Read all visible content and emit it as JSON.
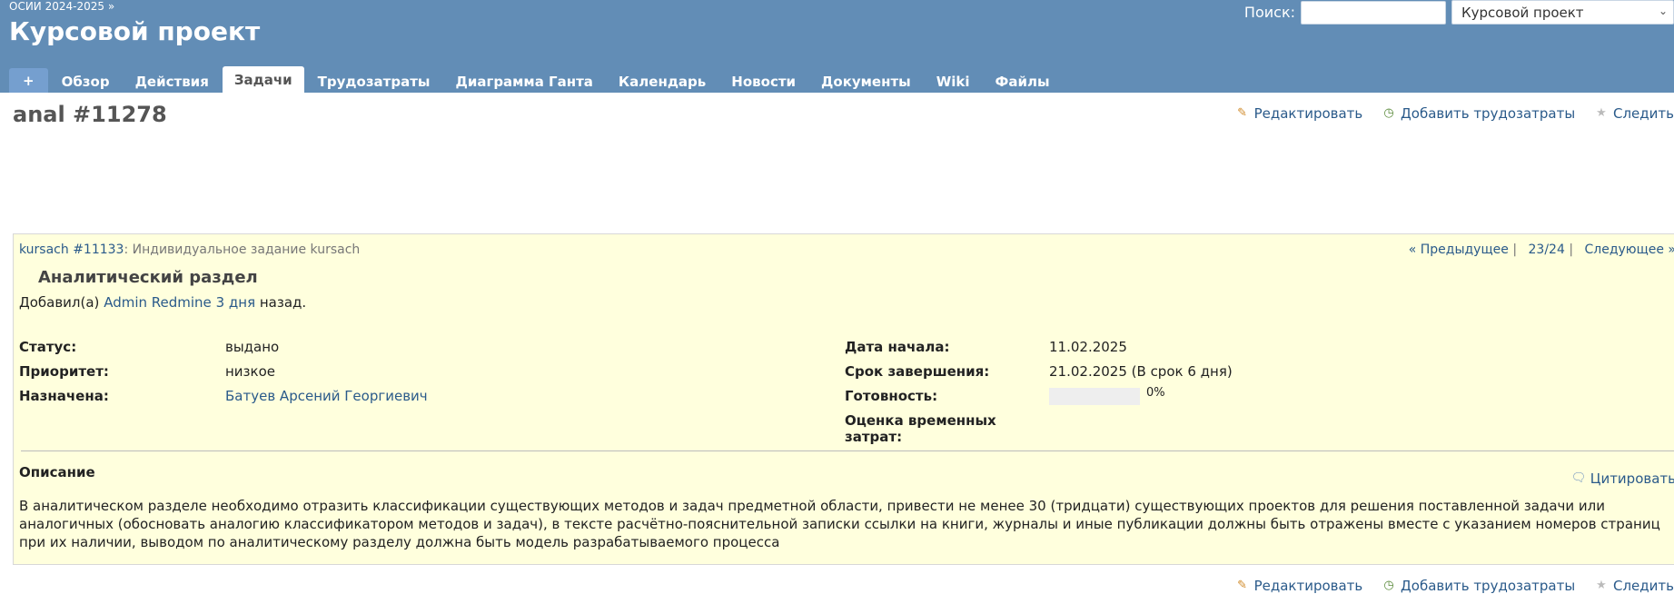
{
  "header": {
    "breadcrumb": "ОСИИ 2024-2025 »",
    "project_title": "Курсовой проект",
    "search_label": "Поиск:",
    "search_value": "",
    "project_select": "Курсовой проект"
  },
  "tabs": [
    {
      "label": "+"
    },
    {
      "label": "Обзор"
    },
    {
      "label": "Действия"
    },
    {
      "label": "Задачи",
      "selected": true
    },
    {
      "label": "Трудозатраты"
    },
    {
      "label": "Диаграмма Ганта"
    },
    {
      "label": "Календарь"
    },
    {
      "label": "Новости"
    },
    {
      "label": "Документы"
    },
    {
      "label": "Wiki"
    },
    {
      "label": "Файлы"
    }
  ],
  "issue": {
    "title": "anal #11278",
    "actions": {
      "edit": "Редактировать",
      "log_time": "Добавить трудозатраты",
      "watch": "Следить"
    },
    "parent_link": "kursach #11133",
    "parent_subject": ": Индивидуальное задание kursach",
    "nav": {
      "prev": "« Предыдущее",
      "sep": "|",
      "position": "23/24",
      "next": "Следующее »"
    },
    "subject": "Аналитический раздел",
    "author": {
      "added_by": "Добавил(а)",
      "name": "Admin Redmine",
      "ago": "3 дня",
      "suffix": "назад."
    },
    "attributes": {
      "status_label": "Статус:",
      "status": "выдано",
      "priority_label": "Приоритет:",
      "priority": "низкое",
      "assignee_label": "Назначена:",
      "assignee": "Батуев Арсений Георгиевич",
      "start_label": "Дата начала:",
      "start": "11.02.2025",
      "due_label": "Срок завершения:",
      "due": "21.02.2025 (В срок 6 дня)",
      "done_label": "Готовность:",
      "done": "0%",
      "done_ratio": 0,
      "estimate_label_1": "Оценка временных",
      "estimate_label_2": "затрат:"
    },
    "description": {
      "heading": "Описание",
      "quote": "Цитировать",
      "text": "В аналитическом разделе необходимо отразить классификации существующих методов и задач предметной области, привести не менее 30 (тридцати) существующих проектов для решения поставленной задачи или аналогичных (обосновать аналогию классификатором методов и задач), в тексте расчётно-пояснительной записки ссылки на книги, журналы и иные публикации должны быть отражены вместе с указанием номеров страниц при их наличии, выводом по аналитическому разделу должна быть модель разрабатываемого процесса"
    }
  },
  "colors": {
    "header_bg": "#628db6",
    "issue_bg": "#ffffdd",
    "link": "#2a5a8a"
  }
}
